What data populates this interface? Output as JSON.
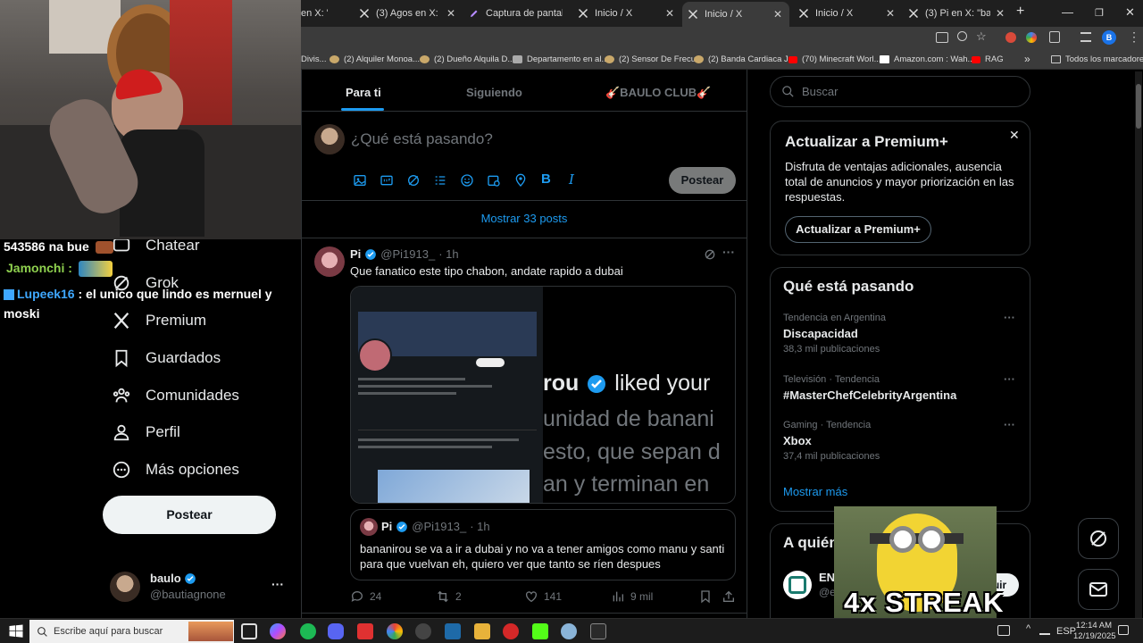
{
  "browser": {
    "tabs": [
      {
        "title": "en X: \""
      },
      {
        "title": "(3) Agos en X: \"@Lpg"
      },
      {
        "title": "Captura de pantalla"
      },
      {
        "title": "Inicio / X"
      },
      {
        "title": "Inicio / X",
        "active": true
      },
      {
        "title": "Inicio / X"
      },
      {
        "title": "(3) Pi en X: \"banan"
      }
    ],
    "new_tab": "+",
    "bookmarks": [
      "Divis...",
      "(2) Alquiler Monoa...",
      "(2) Dueño Alquila D...",
      "Departamento en al...",
      "(2) Sensor De Frecu...",
      "(2) Banda Cardiaca J...",
      "(70) Minecraft Worl...",
      "Amazon.com : Wah...",
      "RAG"
    ],
    "bookmarks_more": "»",
    "all_bookmarks": "Todos los marcadores",
    "profile_initial": "B"
  },
  "chat": [
    {
      "user": "543586 na bue",
      "color": "#ffffff",
      "text": ""
    },
    {
      "user": "Jamonchi :",
      "color": "#8fd14f",
      "text": ""
    },
    {
      "user": "Lupeek16",
      "color": "#3fa8ff",
      "text": ": el unico que lindo es mernuel y moski"
    }
  ],
  "nav": {
    "items": [
      {
        "label": "Chatear",
        "icon": "chat-icon"
      },
      {
        "label": "Grok",
        "icon": "grok-icon"
      },
      {
        "label": "Premium",
        "icon": "x-logo-icon"
      },
      {
        "label": "Guardados",
        "icon": "bookmark-icon"
      },
      {
        "label": "Comunidades",
        "icon": "communities-icon"
      },
      {
        "label": "Perfil",
        "icon": "profile-icon"
      },
      {
        "label": "Más opciones",
        "icon": "more-options-icon"
      }
    ],
    "post_button": "Postear",
    "account": {
      "name": "baulo",
      "handle": "@bautiagnone",
      "more": "···"
    }
  },
  "timeline": {
    "tabs": [
      "Para ti",
      "Siguiendo",
      "🎸BAULO CLUB🎸"
    ],
    "compose_placeholder": "¿Qué está pasando?",
    "compose_post": "Postear",
    "show_more_posts": "Mostrar 33 posts",
    "post": {
      "author": "Pi",
      "handle": "@Pi1913_",
      "time": "· 1h",
      "text": "Que fanatico este tipo chabon, andate rapido a dubai",
      "image_lines": [
        "rou",
        "liked your",
        "unidad de banani",
        "esto, que sepan d",
        "an y terminan en"
      ],
      "quoted": {
        "author": "Pi",
        "handle": "@Pi1913_",
        "time": "· 1h",
        "text": "bananirou se va a ir a dubai y no va a tener amigos como manu y santi para que vuelvan eh, quiero ver que tanto se ríen despues"
      },
      "stats": {
        "replies": "24",
        "reposts": "2",
        "likes": "141",
        "views": "9 mil"
      }
    }
  },
  "sidebar": {
    "search_placeholder": "Buscar",
    "premium": {
      "title": "Actualizar a Premium+",
      "body": "Disfruta de ventajas adicionales, ausencia total de anuncios y mayor priorización en las respuestas.",
      "button": "Actualizar a Premium+"
    },
    "trends": {
      "title": "Qué está pasando",
      "items": [
        {
          "context": "Tendencia en Argentina",
          "name": "Discapacidad",
          "count": "38,3 mil publicaciones"
        },
        {
          "context": "Televisión · Tendencia",
          "name": "#MasterChefCelebrityArgentina",
          "count": ""
        },
        {
          "context": "Gaming · Tendencia",
          "name": "Xbox",
          "count": "37,4 mil publicaciones"
        }
      ],
      "show_more": "Mostrar más"
    },
    "who_to_follow": {
      "title": "A quién",
      "account_name": "EN",
      "account_handle": "@enbajafutbol",
      "follow": "Seguir"
    }
  },
  "overlay": {
    "streak": "4x STREAK"
  },
  "taskbar": {
    "search_placeholder": "Escribe aquí para buscar",
    "language": "ESP",
    "time": "12:14 AM",
    "date": "12/19/2025"
  }
}
